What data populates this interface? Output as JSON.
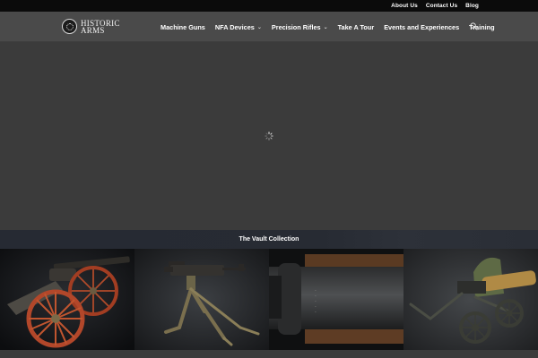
{
  "topbar": {
    "links": [
      "About Us",
      "Contact Us",
      "Blog"
    ]
  },
  "brand": {
    "line1": "HISTORIC",
    "line2": "ARMS"
  },
  "nav": {
    "items": [
      {
        "label": "Machine Guns",
        "dropdown": false
      },
      {
        "label": "NFA Devices",
        "dropdown": true
      },
      {
        "label": "Precision Rifles",
        "dropdown": true
      },
      {
        "label": "Take A Tour",
        "dropdown": false
      },
      {
        "label": "Events and Experiences",
        "dropdown": false
      },
      {
        "label": "Training",
        "dropdown": false
      }
    ],
    "search_icon": "search-icon"
  },
  "hero": {
    "state": "loading",
    "icon": "loading-spinner-icon"
  },
  "vault": {
    "title": "The Vault Collection"
  },
  "gallery": {
    "items": [
      {
        "subject": "field-cannon-image"
      },
      {
        "subject": "tripod-machine-gun-image"
      },
      {
        "subject": "rifle-closeup-image"
      },
      {
        "subject": "wheeled-machine-gun-image"
      }
    ]
  },
  "colors": {
    "topbar_bg": "#0b0b0b",
    "header_bg": "#4a4a4a",
    "hero_bg": "#3b3b3b",
    "band_bg": "#272b33",
    "text": "#ffffff"
  }
}
